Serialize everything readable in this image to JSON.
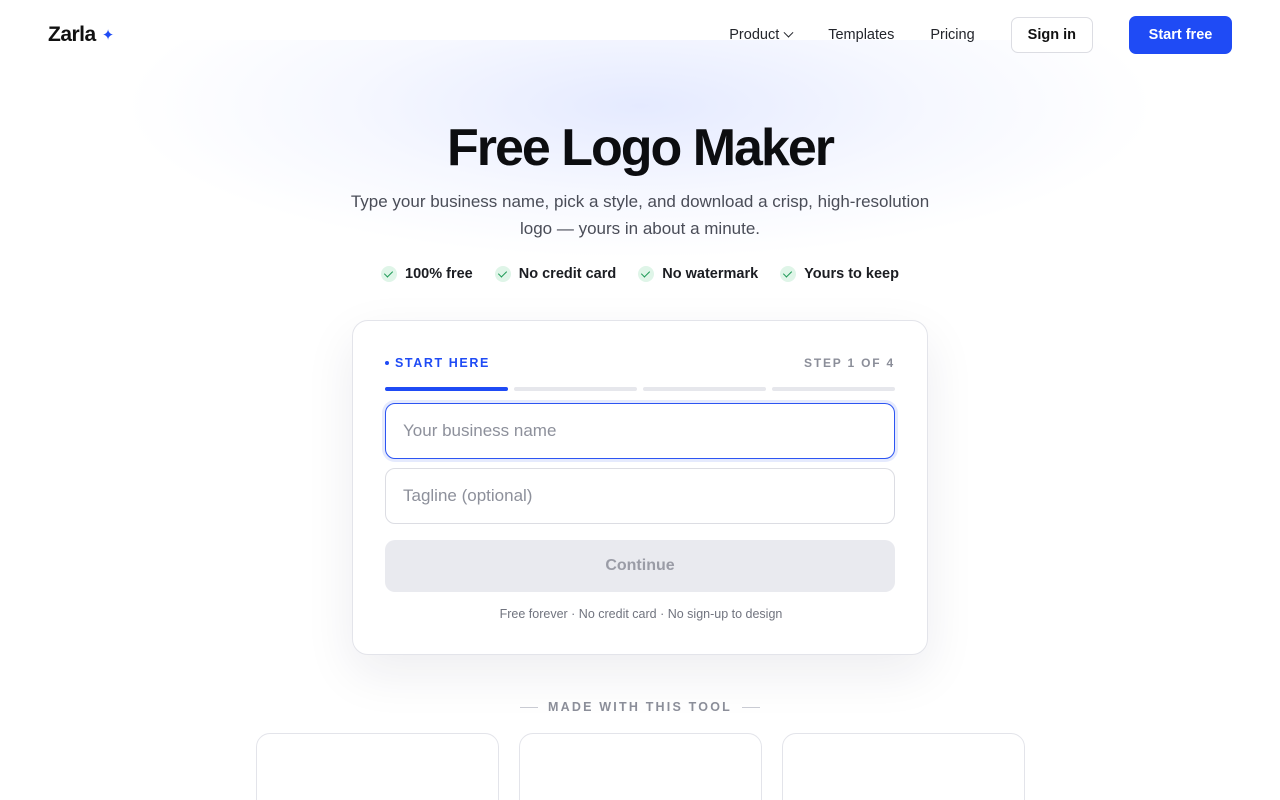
{
  "header": {
    "brand": "Zarla",
    "nav": {
      "product": "Product",
      "templates": "Templates",
      "pricing": "Pricing"
    },
    "sign_in": "Sign in",
    "start_free": "Start free"
  },
  "hero": {
    "title": "Free Logo Maker",
    "subtitle": "Type your business name, pick a style, and download a crisp, high-resolution logo — yours in about a minute.",
    "perks": [
      "100% free",
      "No credit card",
      "No watermark",
      "Yours to keep"
    ]
  },
  "form": {
    "start_label": "START HERE",
    "step_label": "STEP 1 OF 4",
    "step_current": 1,
    "step_total": 4,
    "business_placeholder": "Your business name",
    "tagline_placeholder": "Tagline (optional)",
    "continue_label": "Continue",
    "footnote": "Free forever · No credit card · No sign-up to design"
  },
  "showcase": {
    "heading": "MADE WITH THIS TOOL"
  },
  "colors": {
    "accent": "#1f4bf5",
    "check": "#1f9a57"
  }
}
